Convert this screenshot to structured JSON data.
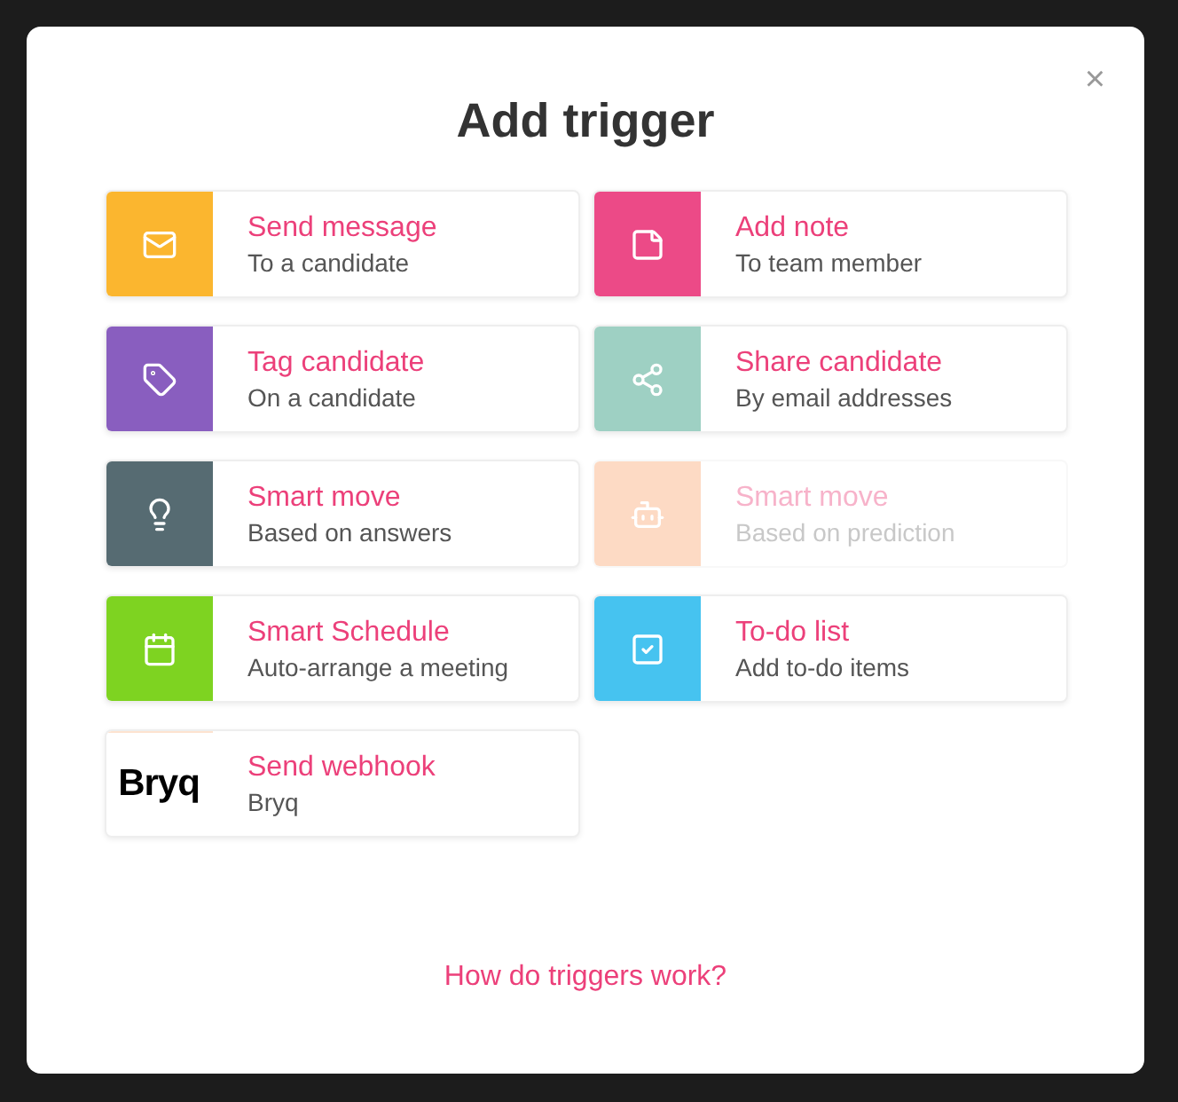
{
  "dialog": {
    "title": "Add trigger",
    "close": "×"
  },
  "triggers": [
    {
      "kind": "icon",
      "color": "#fbb62f",
      "title": "Send message",
      "subtitle": "To a candidate",
      "disabled": false
    },
    {
      "kind": "icon",
      "color": "#ec4a87",
      "title": "Add note",
      "subtitle": "To team member",
      "disabled": false
    },
    {
      "kind": "icon",
      "color": "#895ebf",
      "title": "Tag candidate",
      "subtitle": "On a candidate",
      "disabled": false
    },
    {
      "kind": "icon",
      "color": "#9ed0c3",
      "title": "Share candidate",
      "subtitle": "By email addresses",
      "disabled": false
    },
    {
      "kind": "icon",
      "color": "#566b72",
      "title": "Smart move",
      "subtitle": "Based on answers",
      "disabled": false
    },
    {
      "kind": "icon",
      "color": "#fddac4",
      "title": "Smart move",
      "subtitle": "Based on prediction",
      "disabled": true
    },
    {
      "kind": "icon",
      "color": "#7ed321",
      "title": "Smart Schedule",
      "subtitle": "Auto-arrange a meeting",
      "disabled": false
    },
    {
      "kind": "icon",
      "color": "#46c3f0",
      "title": "To-do list",
      "subtitle": "Add to-do items",
      "disabled": false
    },
    {
      "kind": "logo",
      "logo_text": "Bryq",
      "title": "Send webhook",
      "subtitle": "Bryq",
      "disabled": false
    }
  ],
  "help_link": "How do triggers work?"
}
